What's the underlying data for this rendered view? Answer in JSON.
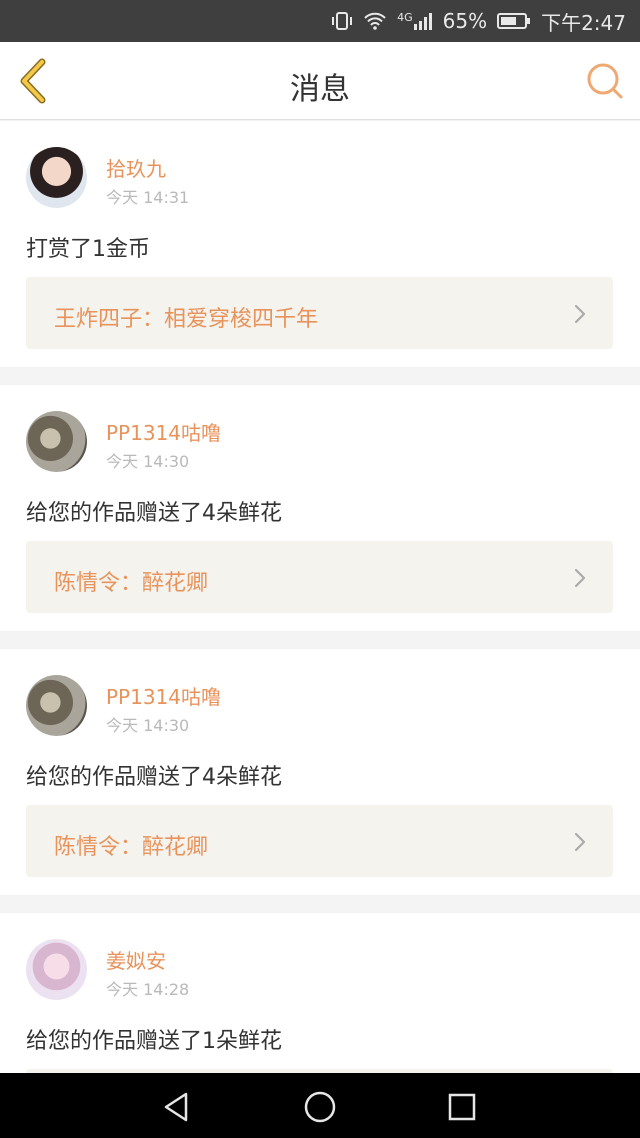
{
  "status_bar": {
    "network": "4G",
    "battery_percent": "65%",
    "time": "下午2:47",
    "icons": [
      "vibrate-icon",
      "wifi-icon",
      "signal-icon",
      "battery-icon"
    ]
  },
  "header": {
    "title": "消息",
    "back_icon": "back-chevron-icon",
    "search_icon": "search-icon"
  },
  "messages": [
    {
      "username": "拾玖九",
      "time": "今天 14:31",
      "action": "打赏了1金币",
      "work": "王炸四子：相爱穿梭四千年"
    },
    {
      "username": "PP1314咕噜",
      "time": "今天 14:30",
      "action": "给您的作品赠送了4朵鲜花",
      "work": "陈情令：醉花卿"
    },
    {
      "username": "PP1314咕噜",
      "time": "今天 14:30",
      "action": "给您的作品赠送了4朵鲜花",
      "work": "陈情令：醉花卿"
    },
    {
      "username": "姜姒安",
      "time": "今天 14:28",
      "action": "给您的作品赠送了1朵鲜花",
      "work": ""
    }
  ],
  "colors": {
    "accent": "#e8935b",
    "status_bar": "#3f3f3f",
    "card_link_bg": "#f4f3ee",
    "back_icon": "#e8b93a"
  }
}
